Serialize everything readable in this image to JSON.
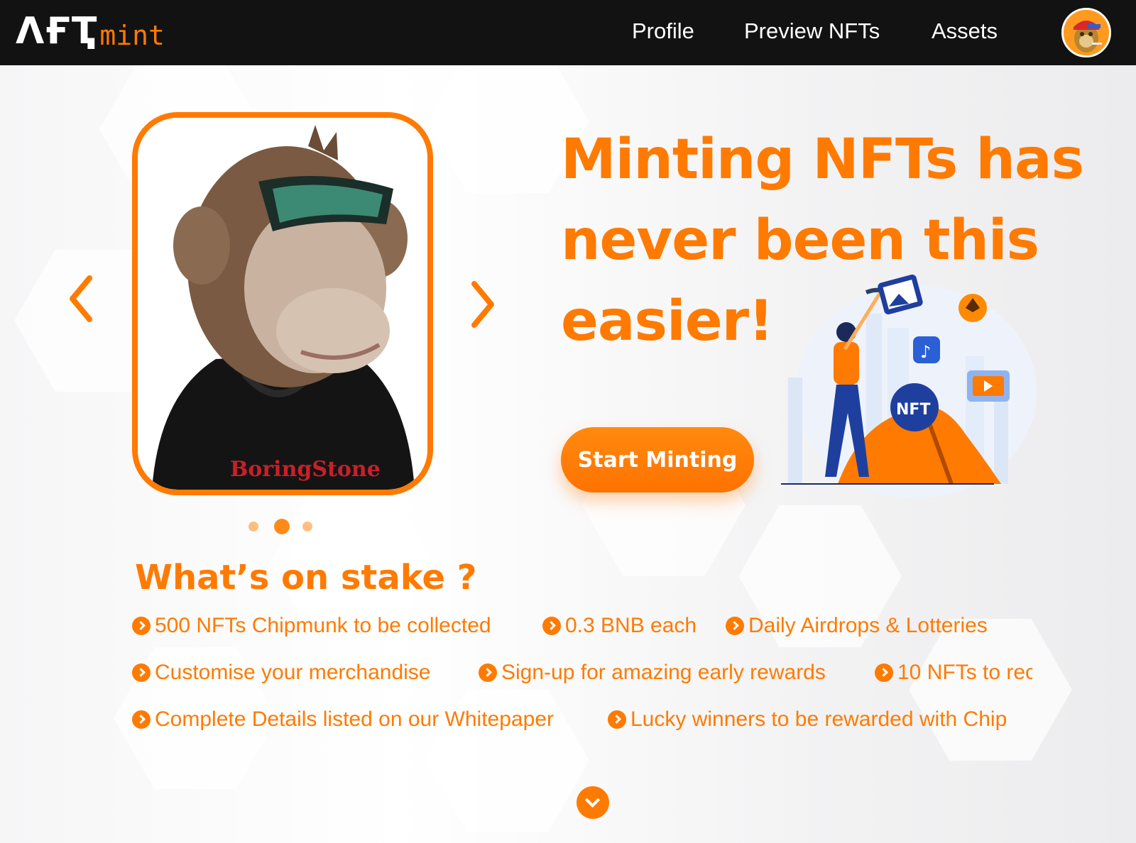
{
  "brand": {
    "logo_mark": "ɅҒҬ",
    "logo_suffix": "mint",
    "accent": "#ff7a00",
    "header_bg": "#121212"
  },
  "nav": {
    "items": [
      {
        "label": "Profile"
      },
      {
        "label": "Preview NFTs"
      },
      {
        "label": "Assets"
      }
    ],
    "avatar_icon": "ape-avatar-icon"
  },
  "hero": {
    "headline_lines": [
      "Minting NFTs has",
      "never been this",
      "easier!"
    ],
    "cta_label": "Start Minting",
    "carousel": {
      "total_slides": 3,
      "active_index": 1,
      "shirt_text": "BoringStone"
    }
  },
  "stake": {
    "title": "What’s on stake ?",
    "rows": [
      [
        "500 NFTs Chipmunk to be collected",
        "0.3 BNB each",
        "Daily Airdrops & Lotteries"
      ],
      [
        "Customise your merchandise",
        "Sign-up for amazing early rewards",
        "10 NFTs to rec"
      ],
      [
        "Complete Details listed on our Whitepaper",
        "Lucky winners to be rewarded with Chip"
      ]
    ]
  }
}
